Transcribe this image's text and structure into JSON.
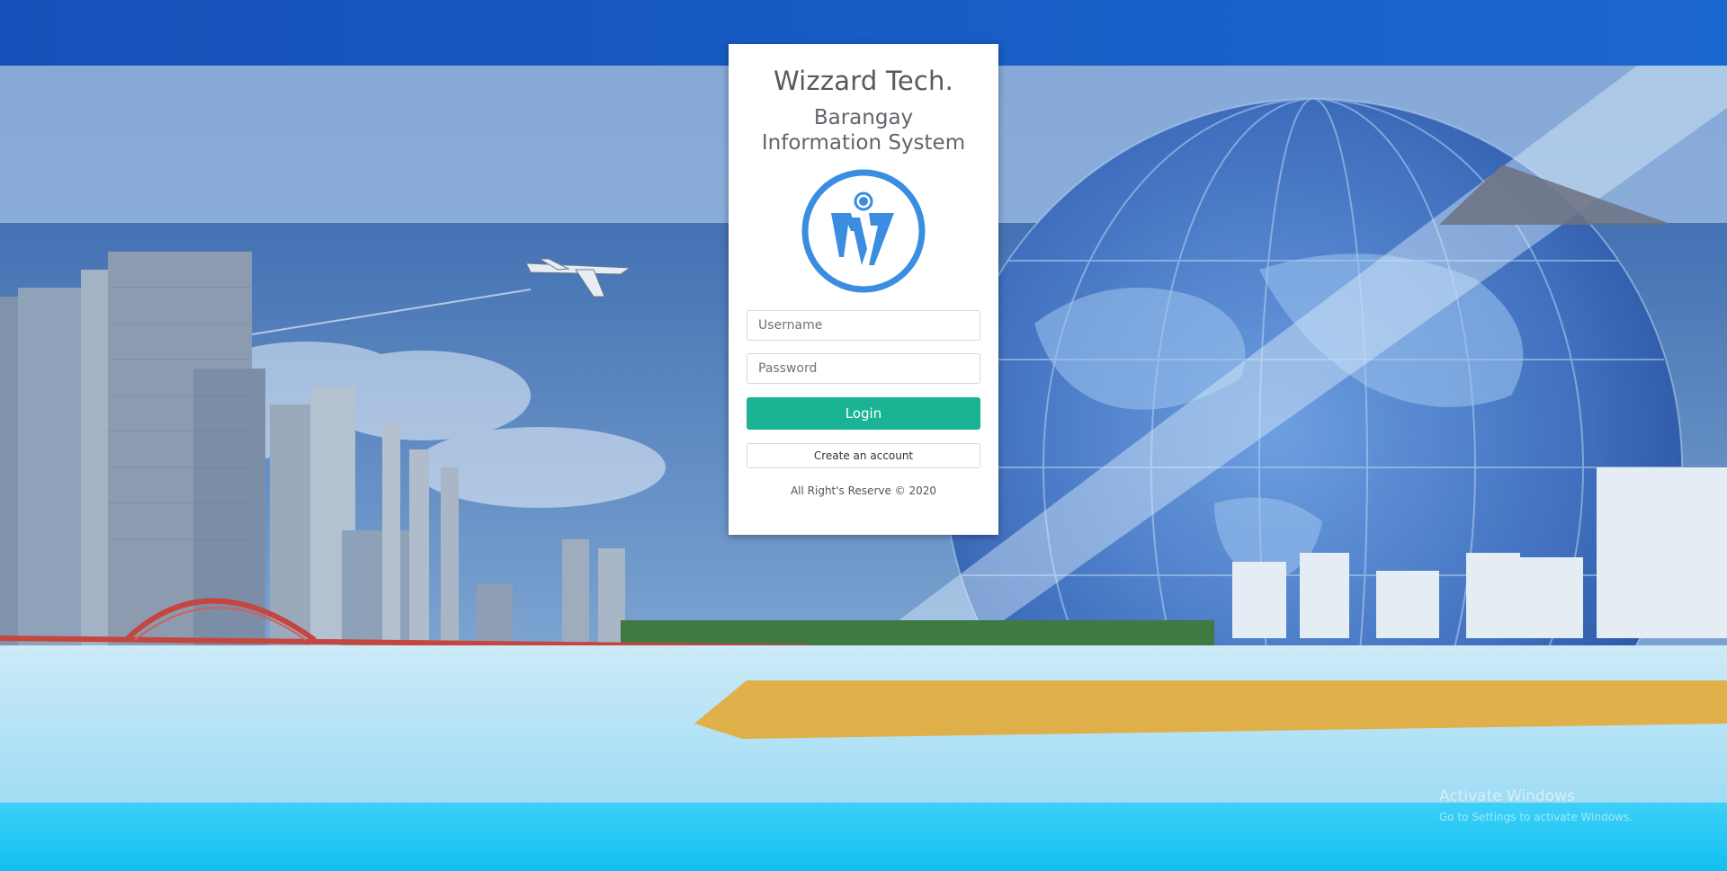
{
  "login_card": {
    "brand": "Wizzard Tech.",
    "subtitle": "Barangay Information System",
    "logo_icon": "wizzard-w-logo",
    "username_placeholder": "Username",
    "password_placeholder": "Password",
    "login_label": "Login",
    "create_account_label": "Create an account",
    "copyright": "All Right's Reserve © 2020"
  },
  "watermark": {
    "title": "Activate Windows",
    "subtitle": "Go to Settings to activate Windows."
  },
  "colors": {
    "accent": "#1ab394",
    "logo": "#3a8de0",
    "header_blue": "#1656c4",
    "footer_cyan": "#25c8f5"
  }
}
